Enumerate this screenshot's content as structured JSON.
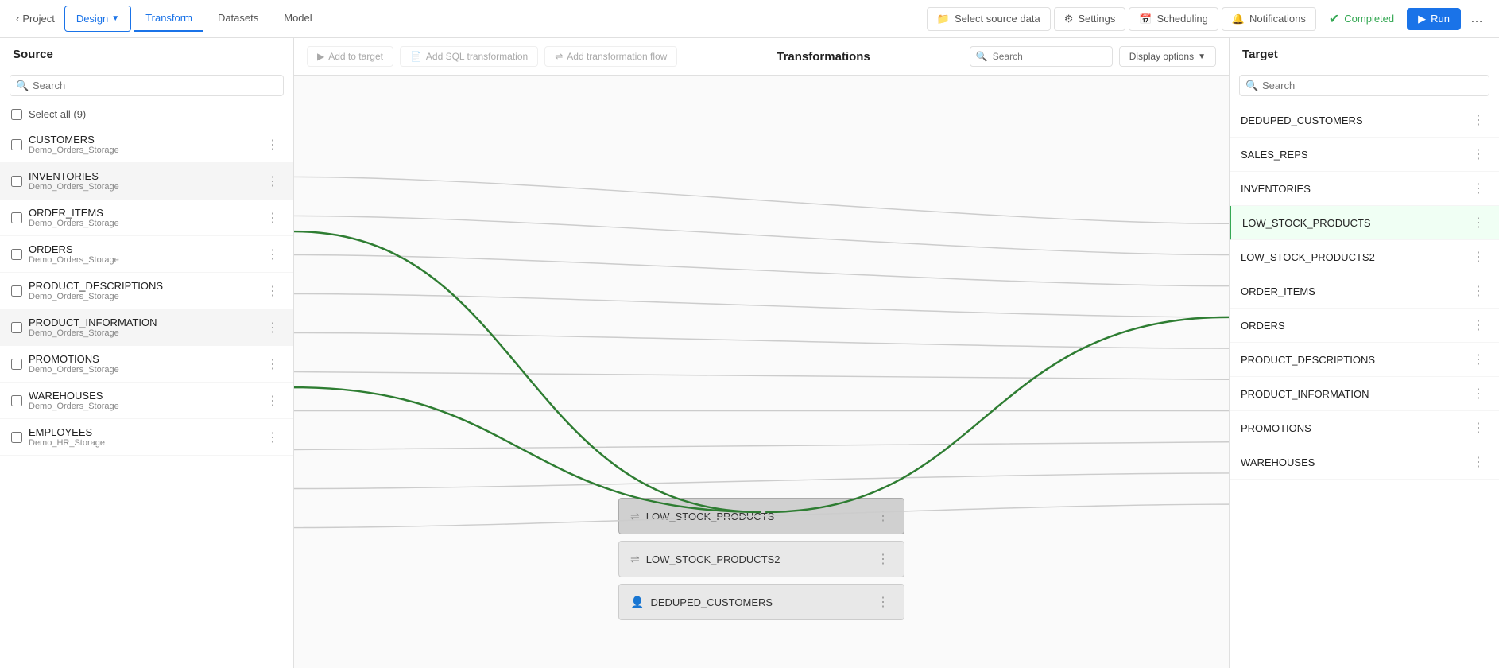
{
  "topnav": {
    "back_label": "Project",
    "tabs": [
      {
        "id": "design",
        "label": "Design",
        "active": true
      },
      {
        "id": "transform",
        "label": "Transform",
        "active": false
      },
      {
        "id": "datasets",
        "label": "Datasets",
        "active": false
      },
      {
        "id": "model",
        "label": "Model",
        "active": false
      }
    ],
    "actions": [
      {
        "id": "select-source",
        "label": "Select source data",
        "icon": "db"
      },
      {
        "id": "settings",
        "label": "Settings",
        "icon": "gear"
      },
      {
        "id": "scheduling",
        "label": "Scheduling",
        "icon": "calendar"
      },
      {
        "id": "notifications",
        "label": "Notifications",
        "icon": "bell"
      }
    ],
    "completed_label": "Completed",
    "run_label": "Run",
    "more_label": "..."
  },
  "source": {
    "title": "Source",
    "search_placeholder": "Search",
    "select_all_label": "Select all (9)",
    "items": [
      {
        "id": "customers",
        "name": "CUSTOMERS",
        "sub": "Demo_Orders_Storage",
        "selected": false,
        "highlighted": false
      },
      {
        "id": "inventories",
        "name": "INVENTORIES",
        "sub": "Demo_Orders_Storage",
        "selected": false,
        "highlighted": true
      },
      {
        "id": "order_items",
        "name": "ORDER_ITEMS",
        "sub": "Demo_Orders_Storage",
        "selected": false,
        "highlighted": false
      },
      {
        "id": "orders",
        "name": "ORDERS",
        "sub": "Demo_Orders_Storage",
        "selected": false,
        "highlighted": false
      },
      {
        "id": "product_descriptions",
        "name": "PRODUCT_DESCRIPTIONS",
        "sub": "Demo_Orders_Storage",
        "selected": false,
        "highlighted": false
      },
      {
        "id": "product_information",
        "name": "PRODUCT_INFORMATION",
        "sub": "Demo_Orders_Storage",
        "selected": false,
        "highlighted": true
      },
      {
        "id": "promotions",
        "name": "PROMOTIONS",
        "sub": "Demo_Orders_Storage",
        "selected": false,
        "highlighted": false
      },
      {
        "id": "warehouses",
        "name": "WAREHOUSES",
        "sub": "Demo_Orders_Storage",
        "selected": false,
        "highlighted": false
      },
      {
        "id": "employees",
        "name": "EMPLOYEES",
        "sub": "Demo_HR_Storage",
        "selected": false,
        "highlighted": false
      }
    ]
  },
  "transformations": {
    "title": "Transformations",
    "add_to_target_label": "Add to target",
    "add_sql_label": "Add SQL transformation",
    "add_flow_label": "Add transformation flow",
    "search_placeholder": "Search",
    "display_options_label": "Display options",
    "nodes": [
      {
        "id": "low_stock_products",
        "name": "LOW_STOCK_PRODUCTS",
        "active": true
      },
      {
        "id": "low_stock_products2",
        "name": "LOW_STOCK_PRODUCTS2",
        "active": false
      },
      {
        "id": "deduped_customers",
        "name": "DEDUPED_CUSTOMERS",
        "active": false
      }
    ]
  },
  "target": {
    "title": "Target",
    "search_placeholder": "Search",
    "items": [
      {
        "id": "deduped_customers",
        "name": "DEDUPED_CUSTOMERS",
        "highlighted": false
      },
      {
        "id": "sales_reps",
        "name": "SALES_REPS",
        "highlighted": false
      },
      {
        "id": "inventories",
        "name": "INVENTORIES",
        "highlighted": false
      },
      {
        "id": "low_stock_products",
        "name": "LOW_STOCK_PRODUCTS",
        "highlighted": true
      },
      {
        "id": "low_stock_products2",
        "name": "LOW_STOCK_PRODUCTS2",
        "highlighted": false
      },
      {
        "id": "order_items",
        "name": "ORDER_ITEMS",
        "highlighted": false
      },
      {
        "id": "orders",
        "name": "ORDERS",
        "highlighted": false
      },
      {
        "id": "product_descriptions",
        "name": "PRODUCT_DESCRIPTIONS",
        "highlighted": false
      },
      {
        "id": "product_information",
        "name": "PRODUCT_INFORMATION",
        "highlighted": false
      },
      {
        "id": "promotions",
        "name": "PROMOTIONS",
        "highlighted": false
      },
      {
        "id": "warehouses",
        "name": "WAREHOUSES",
        "highlighted": false
      }
    ]
  }
}
